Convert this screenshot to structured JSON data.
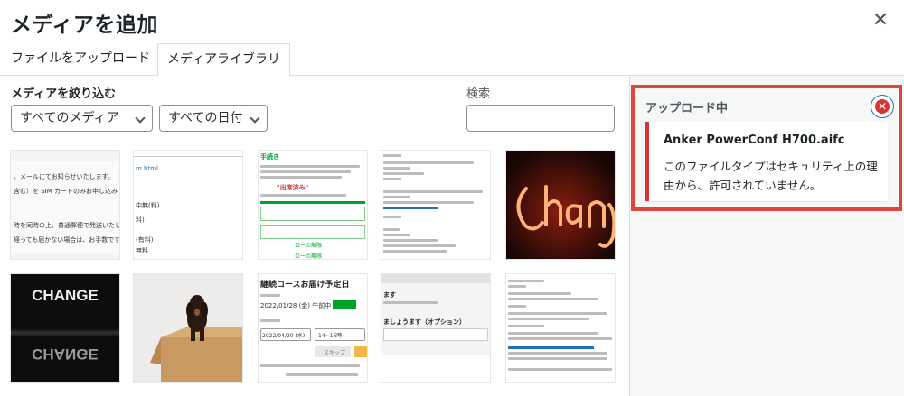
{
  "modal": {
    "title": "メディアを追加",
    "close_glyph": "✕"
  },
  "tabs": [
    {
      "label": "ファイルをアップロード",
      "active": false
    },
    {
      "label": "メディアライブラリ",
      "active": true
    }
  ],
  "filters": {
    "label": "メディアを絞り込む",
    "type_select": "すべてのメディア",
    "date_select": "すべての日付"
  },
  "search": {
    "label": "検索",
    "value": ""
  },
  "thumbnails": {
    "t1": [
      "、メールにてお知らせいたします。",
      "含む）を SIM カードのみお申し込み",
      "時を同時の上、普通郵便で発送いたします",
      "経っても届かない場合は、お手数ですが"
    ],
    "t2": [
      "m.html",
      "中無(料)",
      "料)",
      "(有料)",
      "無料"
    ],
    "t3": [
      "手続き",
      "\"出席済み\"",
      "ローの期限",
      "ローの期限"
    ],
    "t6": [
      "CHANGE",
      "CHANGE"
    ],
    "t8": [
      "継続コースお届け予定日",
      "2022/01/28 (金) 午前中",
      "2022/04/20 (水)",
      "14~16時",
      "スキップ"
    ],
    "t9": [
      "ます",
      "ましょうます（オプション）"
    ]
  },
  "colors": {
    "accent": "#2271b1",
    "error": "#d63638",
    "highlight_frame": "#e0443a"
  },
  "upload": {
    "title": "アップロード中",
    "error_file": "Anker PowerConf H700.aifc",
    "error_message": "このファイルタイプはセキュリティ上の理由から、許可されていません。",
    "dismiss_icon_glyph": "✕"
  }
}
